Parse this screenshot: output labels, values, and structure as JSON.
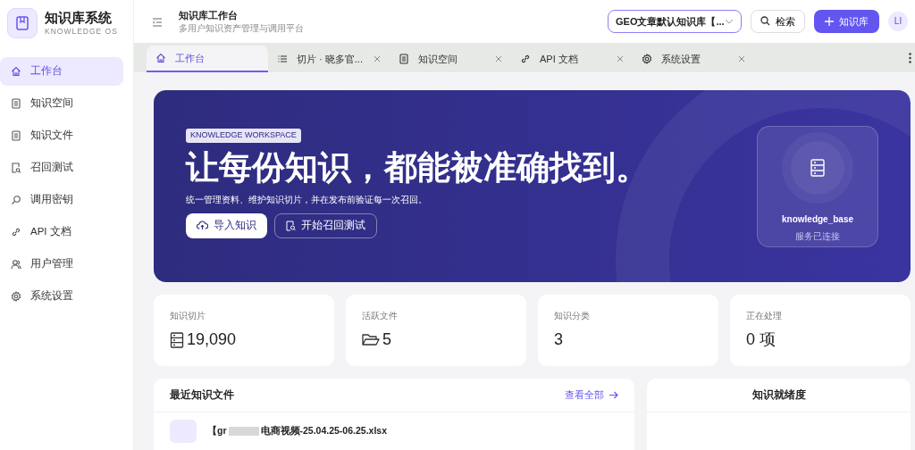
{
  "brand": {
    "title": "知识库系统",
    "subtitle": "KNOWLEDGE OS"
  },
  "sidebar": {
    "items": [
      {
        "label": "工作台",
        "kind": "home",
        "selected": true
      },
      {
        "label": "知识空间",
        "kind": "doc",
        "selected": false
      },
      {
        "label": "知识文件",
        "kind": "doc",
        "selected": false
      },
      {
        "label": "召回测试",
        "kind": "test",
        "selected": false
      },
      {
        "label": "调用密钥",
        "kind": "search",
        "selected": false
      },
      {
        "label": "API 文档",
        "kind": "link",
        "selected": false
      },
      {
        "label": "用户管理",
        "kind": "user",
        "selected": false
      },
      {
        "label": "系统设置",
        "kind": "gear",
        "selected": false
      }
    ]
  },
  "header": {
    "title": "知识库工作台",
    "subtitle": "多用户知识资产管理与调用平台",
    "kb_select": "GEO文章默认知识库【...",
    "search_button": "检索",
    "add_button": "知识库",
    "avatar": "LI"
  },
  "tabs": [
    {
      "label": "工作台",
      "kind": "home",
      "selected": true,
      "closable": false
    },
    {
      "label": "切片 · 晓多官...",
      "kind": "list",
      "selected": false,
      "closable": true
    },
    {
      "label": "知识空间",
      "kind": "doc",
      "selected": false,
      "closable": true
    },
    {
      "label": "API 文档",
      "kind": "link",
      "selected": false,
      "closable": true
    },
    {
      "label": "系统设置",
      "kind": "gear",
      "selected": false,
      "closable": true
    }
  ],
  "hero": {
    "tag": "KNOWLEDGE WORKSPACE",
    "headline": "让每份知识，都能被准确找到。",
    "description": "统一管理资料、维护知识切片，并在发布前验证每一次召回。",
    "primary_button": "导入知识",
    "secondary_button": "开始召回测试",
    "status_card": {
      "name": "knowledge_base",
      "status": "服务已连接"
    }
  },
  "stats": [
    {
      "label": "知识切片",
      "value": "19,090",
      "kind": "server"
    },
    {
      "label": "活跃文件",
      "value": "5",
      "kind": "folder"
    },
    {
      "label": "知识分类",
      "value": "3",
      "kind": "plain"
    },
    {
      "label": "正在处理",
      "value": "0 项",
      "kind": "plain"
    }
  ],
  "recent_files": {
    "title": "最近知识文件",
    "view_all": "查看全部",
    "rows": [
      {
        "name_start": "【gr",
        "name_end": "电商视频-25.04.25-06.25.xlsx"
      }
    ]
  },
  "readiness": {
    "title": "知识就绪度"
  }
}
